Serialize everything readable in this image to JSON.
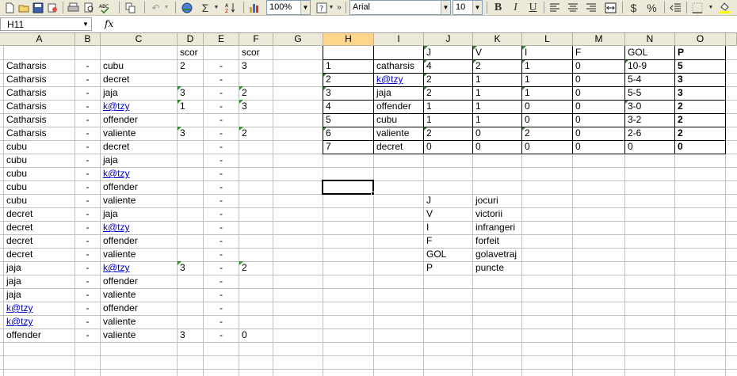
{
  "toolbar": {
    "zoom": "100%",
    "font_name": "Arial",
    "font_size": "10",
    "sigma": "Σ",
    "bold": "B",
    "italic": "I",
    "underline": "U",
    "currency": "$",
    "percent": "%"
  },
  "formula_bar": {
    "name_box": "H11",
    "fx": "fx",
    "content": ""
  },
  "columns": [
    "A",
    "B",
    "C",
    "D",
    "E",
    "F",
    "G",
    "H",
    "I",
    "J",
    "K",
    "L",
    "M",
    "N",
    "O"
  ],
  "selected_column": "H",
  "active_cell": "H11",
  "rows": [
    {
      "A": "",
      "B": "",
      "C": "",
      "D": "scor",
      "E": "",
      "F": "scor",
      "H": "",
      "I": "",
      "J": "J",
      "K": "V",
      "L": "I",
      "M": "F",
      "N": "GOL",
      "O": "P"
    },
    {
      "A": "Catharsis",
      "B": "-",
      "C": "cubu",
      "D": "2",
      "E": "-",
      "F": "3",
      "H": "1",
      "I": "catharsis",
      "J": "4",
      "K": "2",
      "L": "1",
      "M": "0",
      "N": "10-9",
      "O": "5"
    },
    {
      "A": "Catharsis",
      "B": "-",
      "C": "decret",
      "D": "",
      "E": "-",
      "F": "",
      "H": "2",
      "I": "k@tzy",
      "J": "2",
      "K": "1",
      "L": "1",
      "M": "0",
      "N": "5-4",
      "O": "3"
    },
    {
      "A": "Catharsis",
      "B": "-",
      "C": "jaja",
      "D": "3",
      "E": "-",
      "F": "2",
      "H": "3",
      "I": "jaja",
      "J": "2",
      "K": "1",
      "L": "1",
      "M": "0",
      "N": "5-5",
      "O": "3"
    },
    {
      "A": "Catharsis",
      "B": "-",
      "C": "k@tzy",
      "D": "1",
      "E": "-",
      "F": "3",
      "H": "4",
      "I": "offender",
      "J": "1",
      "K": "1",
      "L": "0",
      "M": "0",
      "N": "3-0",
      "O": "2"
    },
    {
      "A": "Catharsis",
      "B": "-",
      "C": "offender",
      "D": "",
      "E": "-",
      "F": "",
      "H": "5",
      "I": "cubu",
      "J": "1",
      "K": "1",
      "L": "0",
      "M": "0",
      "N": "3-2",
      "O": "2"
    },
    {
      "A": "Catharsis",
      "B": "-",
      "C": "valiente",
      "D": "3",
      "E": "-",
      "F": "2",
      "H": "6",
      "I": "valiente",
      "J": "2",
      "K": "0",
      "L": "2",
      "M": "0",
      "N": "2-6",
      "O": "2"
    },
    {
      "A": "cubu",
      "B": "-",
      "C": "decret",
      "D": "",
      "E": "-",
      "F": "",
      "H": "7",
      "I": "decret",
      "J": "0",
      "K": "0",
      "L": "0",
      "M": "0",
      "N": "0",
      "O": "0"
    },
    {
      "A": "cubu",
      "B": "-",
      "C": "jaja",
      "D": "",
      "E": "-",
      "F": ""
    },
    {
      "A": "cubu",
      "B": "-",
      "C": "k@tzy",
      "D": "",
      "E": "-",
      "F": ""
    },
    {
      "A": "cubu",
      "B": "-",
      "C": "offender",
      "D": "",
      "E": "-",
      "F": ""
    },
    {
      "A": "cubu",
      "B": "-",
      "C": "valiente",
      "D": "",
      "E": "-",
      "F": "",
      "J": "J",
      "K": "jocuri"
    },
    {
      "A": "decret",
      "B": "-",
      "C": "jaja",
      "D": "",
      "E": "-",
      "F": "",
      "J": "V",
      "K": "victorii"
    },
    {
      "A": "decret",
      "B": "-",
      "C": "k@tzy",
      "D": "",
      "E": "-",
      "F": "",
      "J": "I",
      "K": "infrangeri"
    },
    {
      "A": "decret",
      "B": "-",
      "C": "offender",
      "D": "",
      "E": "-",
      "F": "",
      "J": "F",
      "K": "forfeit"
    },
    {
      "A": "decret",
      "B": "-",
      "C": "valiente",
      "D": "",
      "E": "-",
      "F": "",
      "J": "GOL",
      "K": "golavetraj"
    },
    {
      "A": "jaja",
      "B": "-",
      "C": "k@tzy",
      "D": "3",
      "E": "-",
      "F": "2",
      "J": "P",
      "K": "puncte"
    },
    {
      "A": "jaja",
      "B": "-",
      "C": "offender",
      "D": "",
      "E": "-",
      "F": ""
    },
    {
      "A": "jaja",
      "B": "-",
      "C": "valiente",
      "D": "",
      "E": "-",
      "F": ""
    },
    {
      "A": "k@tzy",
      "B": "-",
      "C": "offender",
      "D": "",
      "E": "-",
      "F": ""
    },
    {
      "A": "k@tzy",
      "B": "-",
      "C": "valiente",
      "D": "",
      "E": "-",
      "F": ""
    },
    {
      "A": "offender",
      "B": "-",
      "C": "valiente",
      "D": "3",
      "E": "-",
      "F": "0"
    },
    {},
    {}
  ]
}
